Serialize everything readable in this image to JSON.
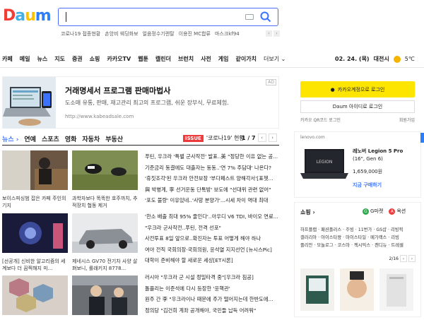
{
  "logo": {
    "letters": [
      "D",
      "a",
      "u",
      "m"
    ],
    "colors": [
      "#f23c34",
      "#40b0e6",
      "#ffc100",
      "#2d7ef7"
    ]
  },
  "search": {
    "value": "",
    "placeholder": ""
  },
  "trending": [
    "코로나19 접종현황",
    "손앙비 웨딩화보",
    "얼음정수기렌탈",
    "이용진 MC합류",
    "마스크kf94"
  ],
  "nav": {
    "items": [
      "카페",
      "메일",
      "뉴스",
      "지도",
      "증권",
      "쇼핑",
      "카카오TV",
      "웹툰",
      "캘린더",
      "브런치",
      "사전",
      "게임",
      "같이가치",
      "더보기 ⌄"
    ],
    "date": "02. 24. (목)",
    "city": "대전시",
    "temp": "5℃"
  },
  "ad": {
    "title": "거래명세서 프로그램 판매마법사",
    "desc": "도소매 유통, 판매, 재고관리 최고의 프로그램, 쉬운 장부식, 무료체험.",
    "url": "http://www.kabeadsale.com",
    "badge": "AD"
  },
  "news": {
    "tabs": [
      "뉴스 ›",
      "연예",
      "스포츠",
      "영화",
      "자동차",
      "부동산"
    ],
    "issue_tag": "ISSUE",
    "issue_text": "'코로나19' 현황",
    "page": "1 / 7",
    "cards": [
      {
        "cap": "보이스피싱범 잡은 카페 주인의 기지"
      },
      {
        "cap": "과학자보다 똑똑한 호주까치, 추적장치 협동 제거"
      },
      {
        "cap": "[선공개] 신비한 알고리즘의 세계보다 더 끔찍해지 미..."
      },
      {
        "cap": "제네시스 GV70 전기차 사양 살펴보니, 롤래키지 8778..."
      },
      {
        "cap": ""
      },
      {
        "cap": ""
      }
    ],
    "headlines": [
      "푸틴, 우크라 '특별 군사작전' 발표..美 \"정당한 이유 없는 공...",
      "기준금리 동결에도 대출자는 동동..'연 7% 주담대' 나온다?",
      "'휴짓조각'된 우크라 안전보장 '부다페스트 양해각서'[표쳇...",
      "與 박병계, 李 선거운동 단톡방' 보도에 \"선대위 관련 없어\"",
      "'포도 불량' 이유있네..'사망 분양가'...시세 차이 역대 최대",
      "'한소 배출 최대 95% 줄인다'..아우디 V6 TDI, 바이오 연료...",
      "\"우크라 군사작전..푸틴, 전격 선포\"",
      "사전투표 8일 앞으로..확진자는 투표 어떻게 해야 하나",
      "여야 전직 국회의장·국회의원, 윤석열 지지선언 [뉴시스Pic]",
      "대학이 준비해야 할 새로운 세상[ET시론]",
      "러시아 \"우크라 군 시설 정밀타격 중\"[우크라 침공]",
      "톨플리는 이준석에 다시 등장한 '윤핵관'",
      "원주 간 李 \"우크라이나 때문에 주가 떨어지는데 한반도에...",
      "정의당 \"김건희 계좌 공개해야, 국민들 납득 어려워\""
    ]
  },
  "login": {
    "kakao": "카카오계정으로 로그인",
    "daum": "Daum 아이디로 로그인",
    "qr": "카카오 QR코드 로그인",
    "signup": "회원가입"
  },
  "lenovo": {
    "url": "lenovo.com",
    "name1": "레노버 Legion 5 Pro",
    "name2": "(16\", Gen 6)",
    "price": "1,659,000원",
    "cta": "지금 구매하기",
    "screen_label": "LEGION"
  },
  "shopping": {
    "title": "쇼핑 ›",
    "gmarket": "G마켓",
    "auction": "옥션",
    "links": [
      "하프플랩 · 패션플러스 · 주빙 · 11번가 · GS샵 · 리빙픽",
      "갤러리아 · 아이스타왕 · 마이스타일 · 메가랙스 · 리빙",
      "플리안 · 모놀로그 · 코스마 · 젝시믹스 · 캔디뉴 · 트레셀"
    ],
    "page": "2/16"
  },
  "colors": {
    "accent": "#3b73ff",
    "kakao": "#fee500",
    "issue": "#ee3a3a"
  }
}
